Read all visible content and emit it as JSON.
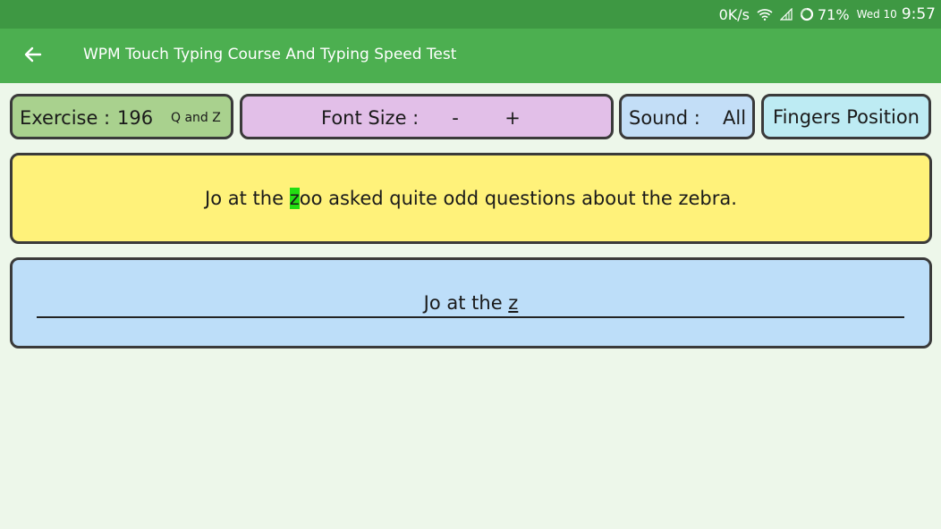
{
  "status_bar": {
    "net_speed": "0K/s",
    "battery": "71%",
    "day": "Wed 10",
    "time": "9:57"
  },
  "app_bar": {
    "title": "WPM Touch Typing Course And Typing Speed Test",
    "back_icon": "arrow-left-icon"
  },
  "controls": {
    "exercise_label": "Exercise :",
    "exercise_number": "196",
    "exercise_keys": "Q and Z",
    "font_size_label": "Font Size :",
    "font_minus": "-",
    "font_plus": "+",
    "sound_label": "Sound :",
    "sound_value": "All",
    "fingers_label": "Fingers Position"
  },
  "target": {
    "before": "Jo at the ",
    "current_char": "z",
    "after": "oo asked quite odd questions about the zebra."
  },
  "input": {
    "typed": "Jo at the ",
    "current": "z"
  },
  "colors": {
    "status_bar": "#3E9843",
    "app_bar": "#4CAF50",
    "background": "#EDF7EA",
    "exercise_btn": "#A9D18E",
    "font_btn": "#E2BFE8",
    "sound_btn": "#C3DEF7",
    "fingers_btn": "#BDEBF3",
    "target_panel": "#FFF27A",
    "input_panel": "#BDDEF9",
    "highlight": "#22DD11"
  }
}
